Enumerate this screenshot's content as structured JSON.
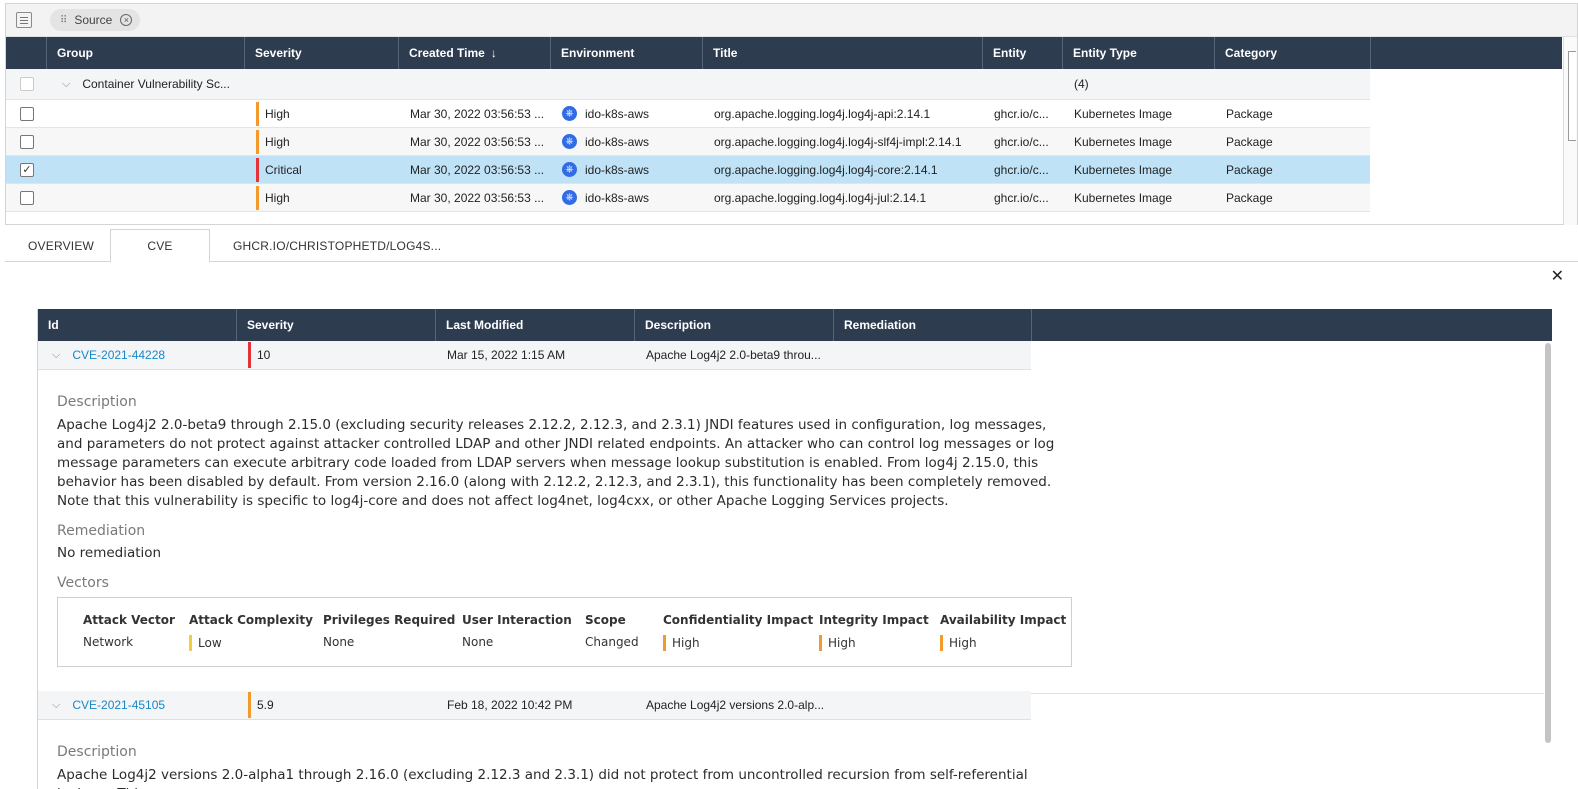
{
  "toolbar": {
    "chip_label": "Source"
  },
  "grid": {
    "columns": [
      "Group",
      "Severity",
      "Created Time",
      "Environment",
      "Title",
      "Entity",
      "Entity Type",
      "Category"
    ],
    "sort_indicator": "↓",
    "group_row": {
      "label": "Container Vulnerability Sc...",
      "count": "(4)"
    },
    "rows": [
      {
        "severity": "High",
        "created": "Mar 30, 2022 03:56:53 ...",
        "env": "ido-k8s-aws",
        "title": "org.apache.logging.log4j.log4j-api:2.14.1",
        "entity": "ghcr.io/c...",
        "entity_type": "Kubernetes Image",
        "category": "Package"
      },
      {
        "severity": "High",
        "created": "Mar 30, 2022 03:56:53 ...",
        "env": "ido-k8s-aws",
        "title": "org.apache.logging.log4j.log4j-slf4j-impl:2.14.1",
        "entity": "ghcr.io/c...",
        "entity_type": "Kubernetes Image",
        "category": "Package"
      },
      {
        "severity": "Critical",
        "created": "Mar 30, 2022 03:56:53 ...",
        "env": "ido-k8s-aws",
        "title": "org.apache.logging.log4j.log4j-core:2.14.1",
        "entity": "ghcr.io/c...",
        "entity_type": "Kubernetes Image",
        "category": "Package"
      },
      {
        "severity": "High",
        "created": "Mar 30, 2022 03:56:53 ...",
        "env": "ido-k8s-aws",
        "title": "org.apache.logging.log4j.log4j-jul:2.14.1",
        "entity": "ghcr.io/c...",
        "entity_type": "Kubernetes Image",
        "category": "Package"
      }
    ]
  },
  "tabs": [
    "OVERVIEW",
    "CVE",
    "GHCR.IO/CHRISTOPHETD/LOG4S..."
  ],
  "cve": {
    "columns": [
      "Id",
      "Severity",
      "Last Modified",
      "Description",
      "Remediation"
    ],
    "rows": [
      {
        "id": "CVE-2021-44228",
        "score": "10",
        "modified": "Mar 15, 2022 1:15 AM",
        "desc_short": "Apache Log4j2 2.0-beta9 throu...",
        "description_label": "Description",
        "description": "Apache Log4j2 2.0-beta9 through 2.15.0 (excluding security releases 2.12.2, 2.12.3, and 2.3.1) JNDI features used in configuration, log messages, and parameters do not protect against attacker controlled LDAP and other JNDI related endpoints. An attacker who can control log messages or log message parameters can execute arbitrary code loaded from LDAP servers when message lookup substitution is enabled. From log4j 2.15.0, this behavior has been disabled by default. From version 2.16.0 (along with 2.12.2, 2.12.3, and 2.3.1), this functionality has been completely removed. Note that this vulnerability is specific to log4j-core and does not affect log4net, log4cxx, or other Apache Logging Services projects.",
        "remediation_label": "Remediation",
        "remediation": "No remediation",
        "vectors_label": "Vectors",
        "vectors": [
          {
            "h": "Attack Vector",
            "v": "Network"
          },
          {
            "h": "Attack Complexity",
            "v": "Low"
          },
          {
            "h": "Privileges Required",
            "v": "None"
          },
          {
            "h": "User Interaction",
            "v": "None"
          },
          {
            "h": "Scope",
            "v": "Changed"
          },
          {
            "h": "Confidentiality Impact",
            "v": "High"
          },
          {
            "h": "Integrity Impact",
            "v": "High"
          },
          {
            "h": "Availability Impact",
            "v": "High"
          }
        ]
      },
      {
        "id": "CVE-2021-45105",
        "score": "5.9",
        "modified": "Feb 18, 2022 10:42 PM",
        "desc_short": "Apache Log4j2 versions 2.0-alp...",
        "description_label": "Description",
        "description": "Apache Log4j2 versions 2.0-alpha1 through 2.16.0 (excluding 2.12.3 and 2.3.1) did not protect from uncontrolled recursion from self-referential lookups. This"
      }
    ]
  },
  "colors": {
    "high": "#f39a2c",
    "critical": "#e2333a",
    "low": "#f5cd3b",
    "header_bg": "#2e3c50",
    "link": "#1a86c7",
    "selected": "#bfe2f7"
  }
}
